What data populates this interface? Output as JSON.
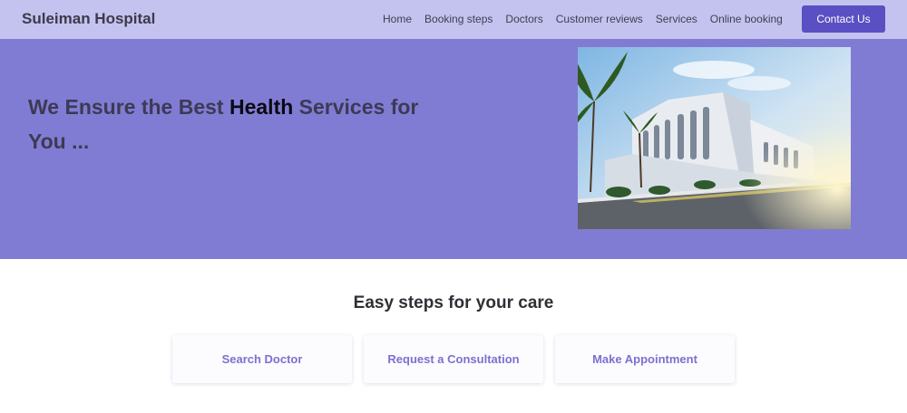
{
  "header": {
    "brand": "Suleiman Hospital",
    "nav": [
      "Home",
      "Booking steps",
      "Doctors",
      "Customer reviews",
      "Services",
      "Online booking"
    ],
    "contact_label": "Contact Us"
  },
  "hero": {
    "headline_before": "We Ensure the Best ",
    "headline_highlight": "Health",
    "headline_after": " Services for You ..."
  },
  "steps": {
    "title": "Easy steps for your care",
    "cards": [
      "Search Doctor",
      "Request a Consultation",
      "Make Appointment"
    ]
  },
  "colors": {
    "navbar_bg": "#c4c3ef",
    "hero_bg": "#817cd3",
    "accent": "#5a4fc3",
    "card_text": "#7b71d0"
  }
}
